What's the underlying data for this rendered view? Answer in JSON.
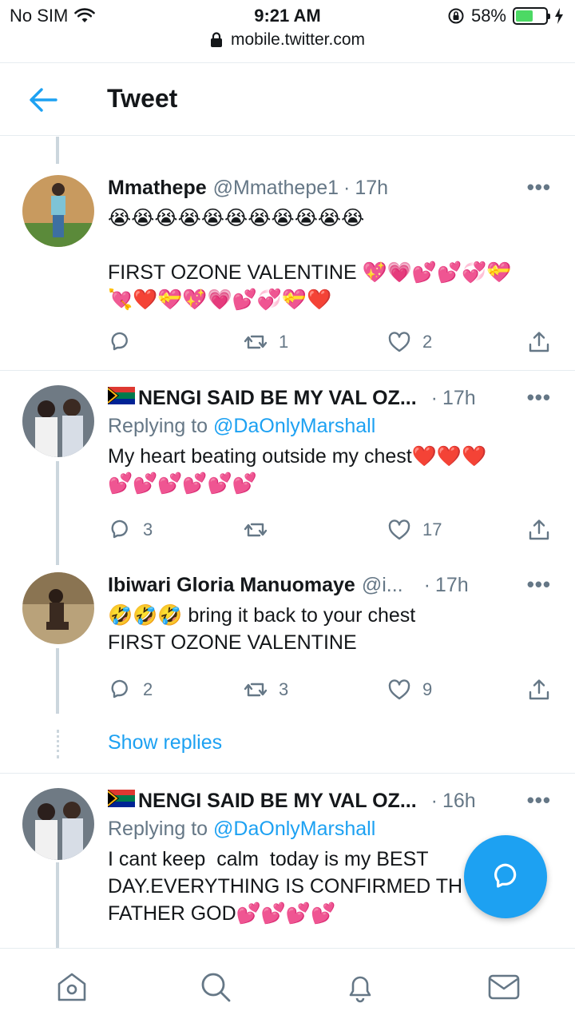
{
  "status_bar": {
    "carrier": "No SIM",
    "time": "9:21 AM",
    "battery_percent": "58%",
    "battery_level": 0.58,
    "url": "mobile.twitter.com"
  },
  "header": {
    "title": "Tweet"
  },
  "tweets": [
    {
      "name": "Mmathepe",
      "handle": "@Mmathepe1",
      "time": "17h",
      "text": "😭😭😭😭😭😭😭😭😭😭😭\n\nFIRST OZONE VALENTINE 💖💗💕💕💞💝\n💘❤️💝💖💗💕💞💝❤️",
      "replies": "",
      "retweets": "1",
      "likes": "2"
    },
    {
      "name": "NENGI SAID BE MY VAL OZ...",
      "handle": "",
      "time": "17h",
      "replying_label": "Replying to",
      "replying_to": "@DaOnlyMarshall",
      "text": "My heart beating outside my chest❤️❤️❤️\n💕💕💕💕💕💕",
      "replies": "3",
      "retweets": "",
      "likes": "17"
    },
    {
      "name": "Ibiwari Gloria Manuomaye",
      "handle": "@i...",
      "time": "17h",
      "text": "🤣🤣🤣 bring it back to your chest\nFIRST OZONE VALENTINE",
      "replies": "2",
      "retweets": "3",
      "likes": "9"
    },
    {
      "name": "NENGI SAID BE MY VAL OZ...",
      "handle": "",
      "time": "16h",
      "replying_label": "Replying to",
      "replying_to": "@DaOnlyMarshall",
      "text": "I cant keep  calm  today is my BEST\nDAY.EVERYTHING IS CONFIRMED TH\nFATHER GOD💕💕💕💕",
      "replies": "",
      "retweets": "",
      "likes": ""
    }
  ],
  "show_replies": "Show replies",
  "more_label": "•••",
  "dot_sep": "·",
  "icons": {
    "back": "back-arrow-icon",
    "reply": "reply-icon",
    "retweet": "retweet-icon",
    "like": "heart-icon",
    "share": "share-icon",
    "compose": "compose-reply-icon",
    "home": "home-icon",
    "search": "search-icon",
    "notifications": "bell-icon",
    "messages": "mail-icon"
  },
  "colors": {
    "accent": "#1da1f2",
    "text": "#14171a",
    "muted": "#657786",
    "divider": "#e6ecf0",
    "battery": "#4cd964"
  }
}
